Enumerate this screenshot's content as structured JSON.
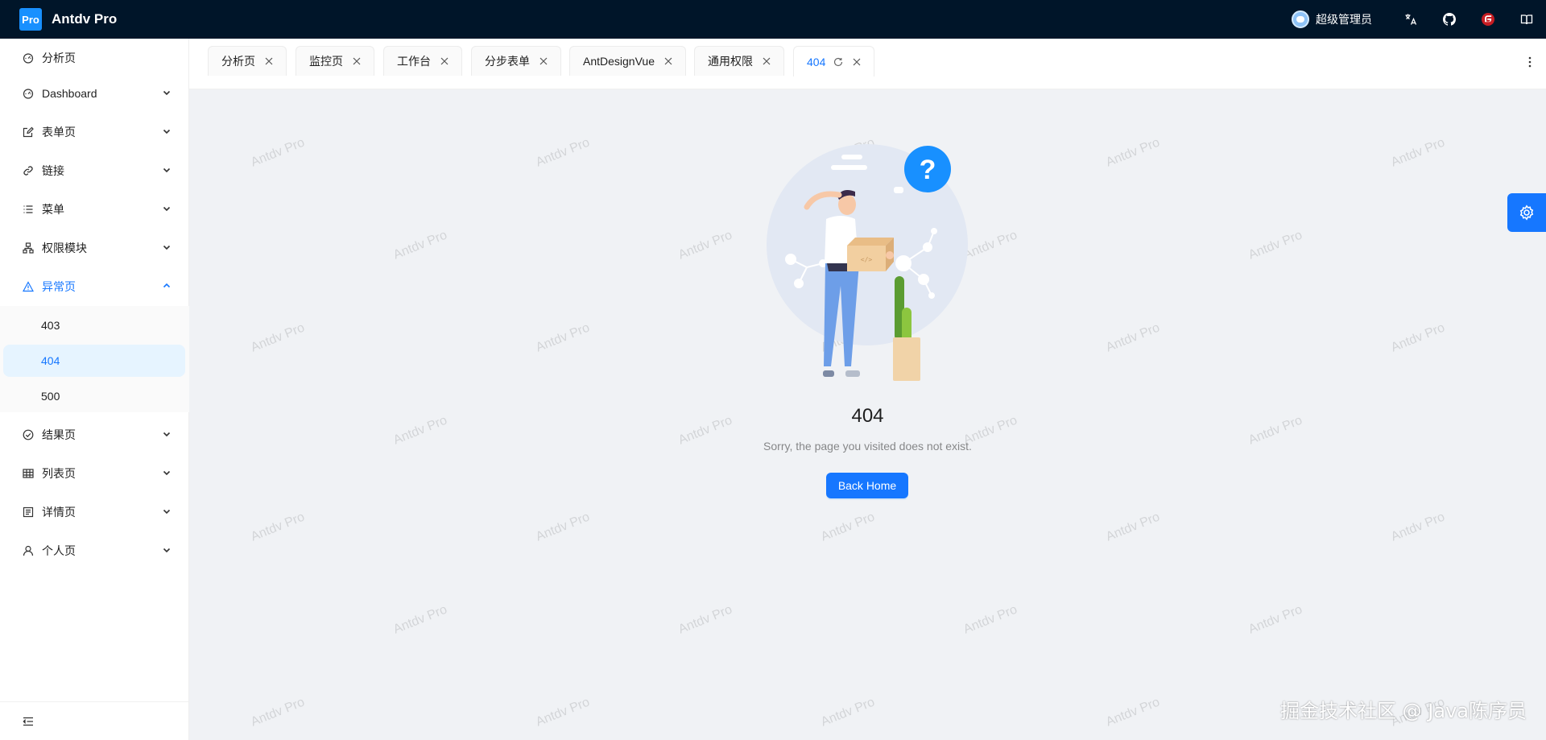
{
  "header": {
    "logo_text": "Pro",
    "app_title": "Antdv Pro",
    "user_name": "超级管理员",
    "icons": [
      "translate-icon",
      "github-icon",
      "gitee-icon",
      "docs-icon"
    ]
  },
  "sidebar": {
    "items": [
      {
        "label": "分析页",
        "icon": "dashboard-icon"
      },
      {
        "label": "Dashboard",
        "icon": "dashboard-icon"
      },
      {
        "label": "表单页",
        "icon": "form-icon"
      },
      {
        "label": "链接",
        "icon": "link-icon"
      },
      {
        "label": "菜单",
        "icon": "menu-list-icon"
      },
      {
        "label": "权限模块",
        "icon": "cluster-icon"
      },
      {
        "label": "异常页",
        "icon": "warning-icon"
      },
      {
        "label": "结果页",
        "icon": "check-circle-icon"
      },
      {
        "label": "列表页",
        "icon": "table-icon"
      },
      {
        "label": "详情页",
        "icon": "profile-icon"
      },
      {
        "label": "个人页",
        "icon": "user-icon"
      }
    ],
    "exception_children": [
      "403",
      "404",
      "500"
    ],
    "selected_child": "404"
  },
  "tabs": [
    {
      "label": "分析页"
    },
    {
      "label": "监控页"
    },
    {
      "label": "工作台"
    },
    {
      "label": "分步表单"
    },
    {
      "label": "AntDesignVue"
    },
    {
      "label": "通用权限"
    },
    {
      "label": "404"
    }
  ],
  "active_tab": "404",
  "content": {
    "title": "404",
    "subtitle": "Sorry, the page you visited does not exist.",
    "button": "Back Home",
    "watermark": "Antdv Pro"
  },
  "footer_credit": "掘金技术社区 @ Java陈序员",
  "colors": {
    "header_bg": "#001529",
    "primary": "#1677ff",
    "content_bg": "#f0f2f5"
  }
}
